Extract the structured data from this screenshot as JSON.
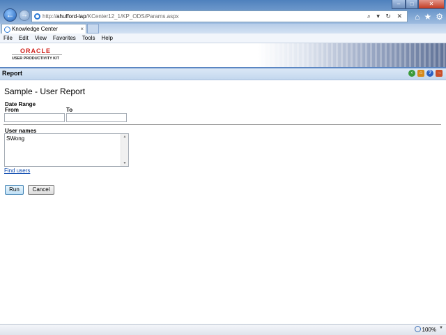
{
  "browser": {
    "url_prefix": "http://",
    "url_host": "ahufford-lap",
    "url_path": "/KCenter12_1/KP_ODS/Params.aspx",
    "tab_title": "Knowledge Center",
    "tab_close": "×",
    "addr_tools": "⌕ ▾ ↻ ✕",
    "menu": [
      "File",
      "Edit",
      "View",
      "Favorites",
      "Tools",
      "Help"
    ],
    "back_icon": "←",
    "forward_icon": "→",
    "toolbar_icons": {
      "home": "⌂",
      "favorites": "★",
      "tools": "⚙"
    },
    "window": {
      "min": "–",
      "max": "□",
      "close": "✕"
    }
  },
  "branding": {
    "logo_text": "ORACLE",
    "logo_sub": "USER PRODUCTIVITY KIT",
    "logo_color": "#d0201b"
  },
  "report_bar": {
    "title": "Report",
    "icons": [
      "back-icon",
      "home-icon",
      "help-icon",
      "exit-icon"
    ]
  },
  "form": {
    "heading": "Sample - User Report",
    "date_range_label": "Date Range",
    "from_label": "From",
    "to_label": "To",
    "from_value": "",
    "to_value": "",
    "users_label": "User names",
    "users_value": "SWong",
    "find_users_link": "Find users",
    "run_button": "Run",
    "cancel_button": "Cancel"
  },
  "status_bar": {
    "zoom": "100%"
  }
}
